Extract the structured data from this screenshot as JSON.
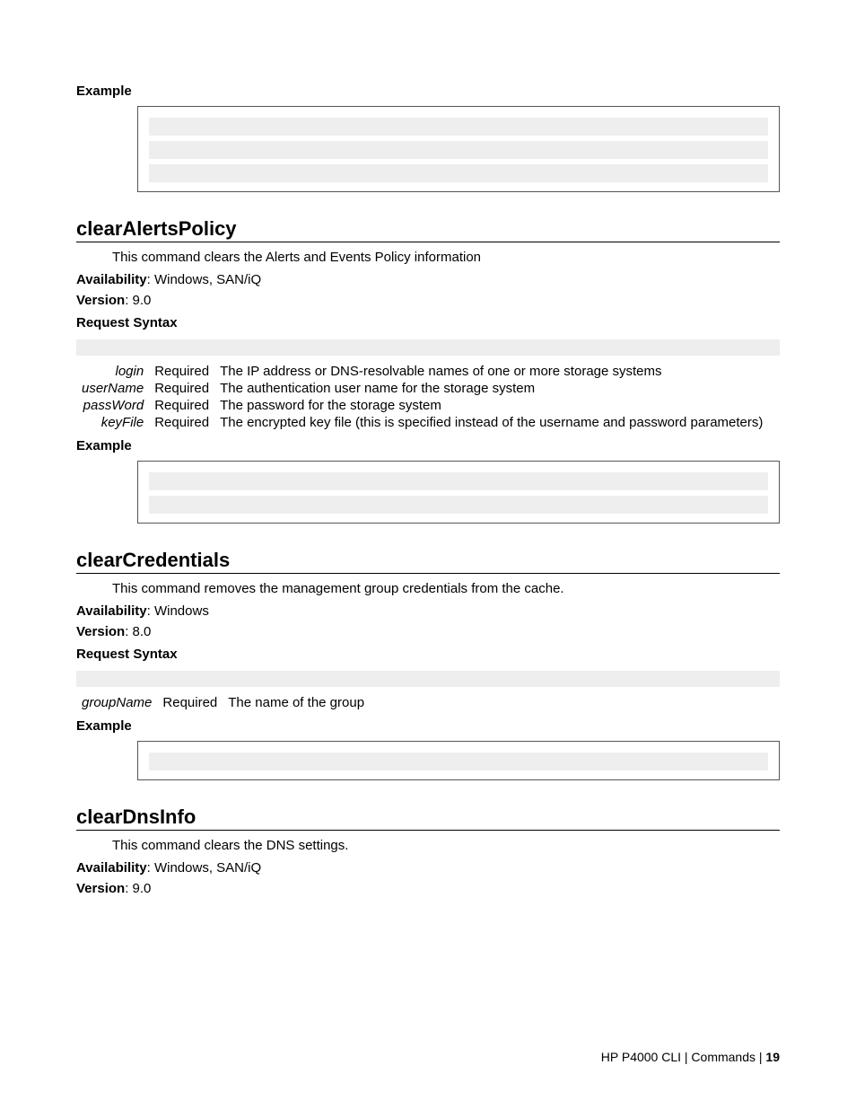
{
  "labels": {
    "example": "Example",
    "availability": "Availability",
    "version": "Version",
    "requestSyntax": "Request Syntax",
    "required": "Required"
  },
  "sections": {
    "clearAlertsPolicy": {
      "title": "clearAlertsPolicy",
      "desc": "This command clears the Alerts and Events Policy information",
      "availability": ": Windows, SAN/iQ",
      "version": ": 9.0",
      "params": {
        "login": {
          "name": "login",
          "desc": "The IP address or DNS-resolvable names of one or more storage systems"
        },
        "userName": {
          "name": "userName",
          "desc": "The authentication user name for the storage system"
        },
        "passWord": {
          "name": "passWord",
          "desc": "The password for the storage system"
        },
        "keyFile": {
          "name": "keyFile",
          "desc": "The encrypted key file (this is specified instead of the username and password parameters)"
        }
      }
    },
    "clearCredentials": {
      "title": "clearCredentials",
      "desc": "This command removes the management group credentials from the cache.",
      "availability": ": Windows",
      "version": ": 8.0",
      "params": {
        "groupName": {
          "name": "groupName",
          "desc": "The name of the group"
        }
      }
    },
    "clearDnsInfo": {
      "title": "clearDnsInfo",
      "desc": "This command clears the DNS settings.",
      "availability": ": Windows, SAN/iQ",
      "version": ": 9.0"
    }
  },
  "footer": {
    "text": "HP P4000 CLI | Commands | ",
    "page": "19"
  }
}
